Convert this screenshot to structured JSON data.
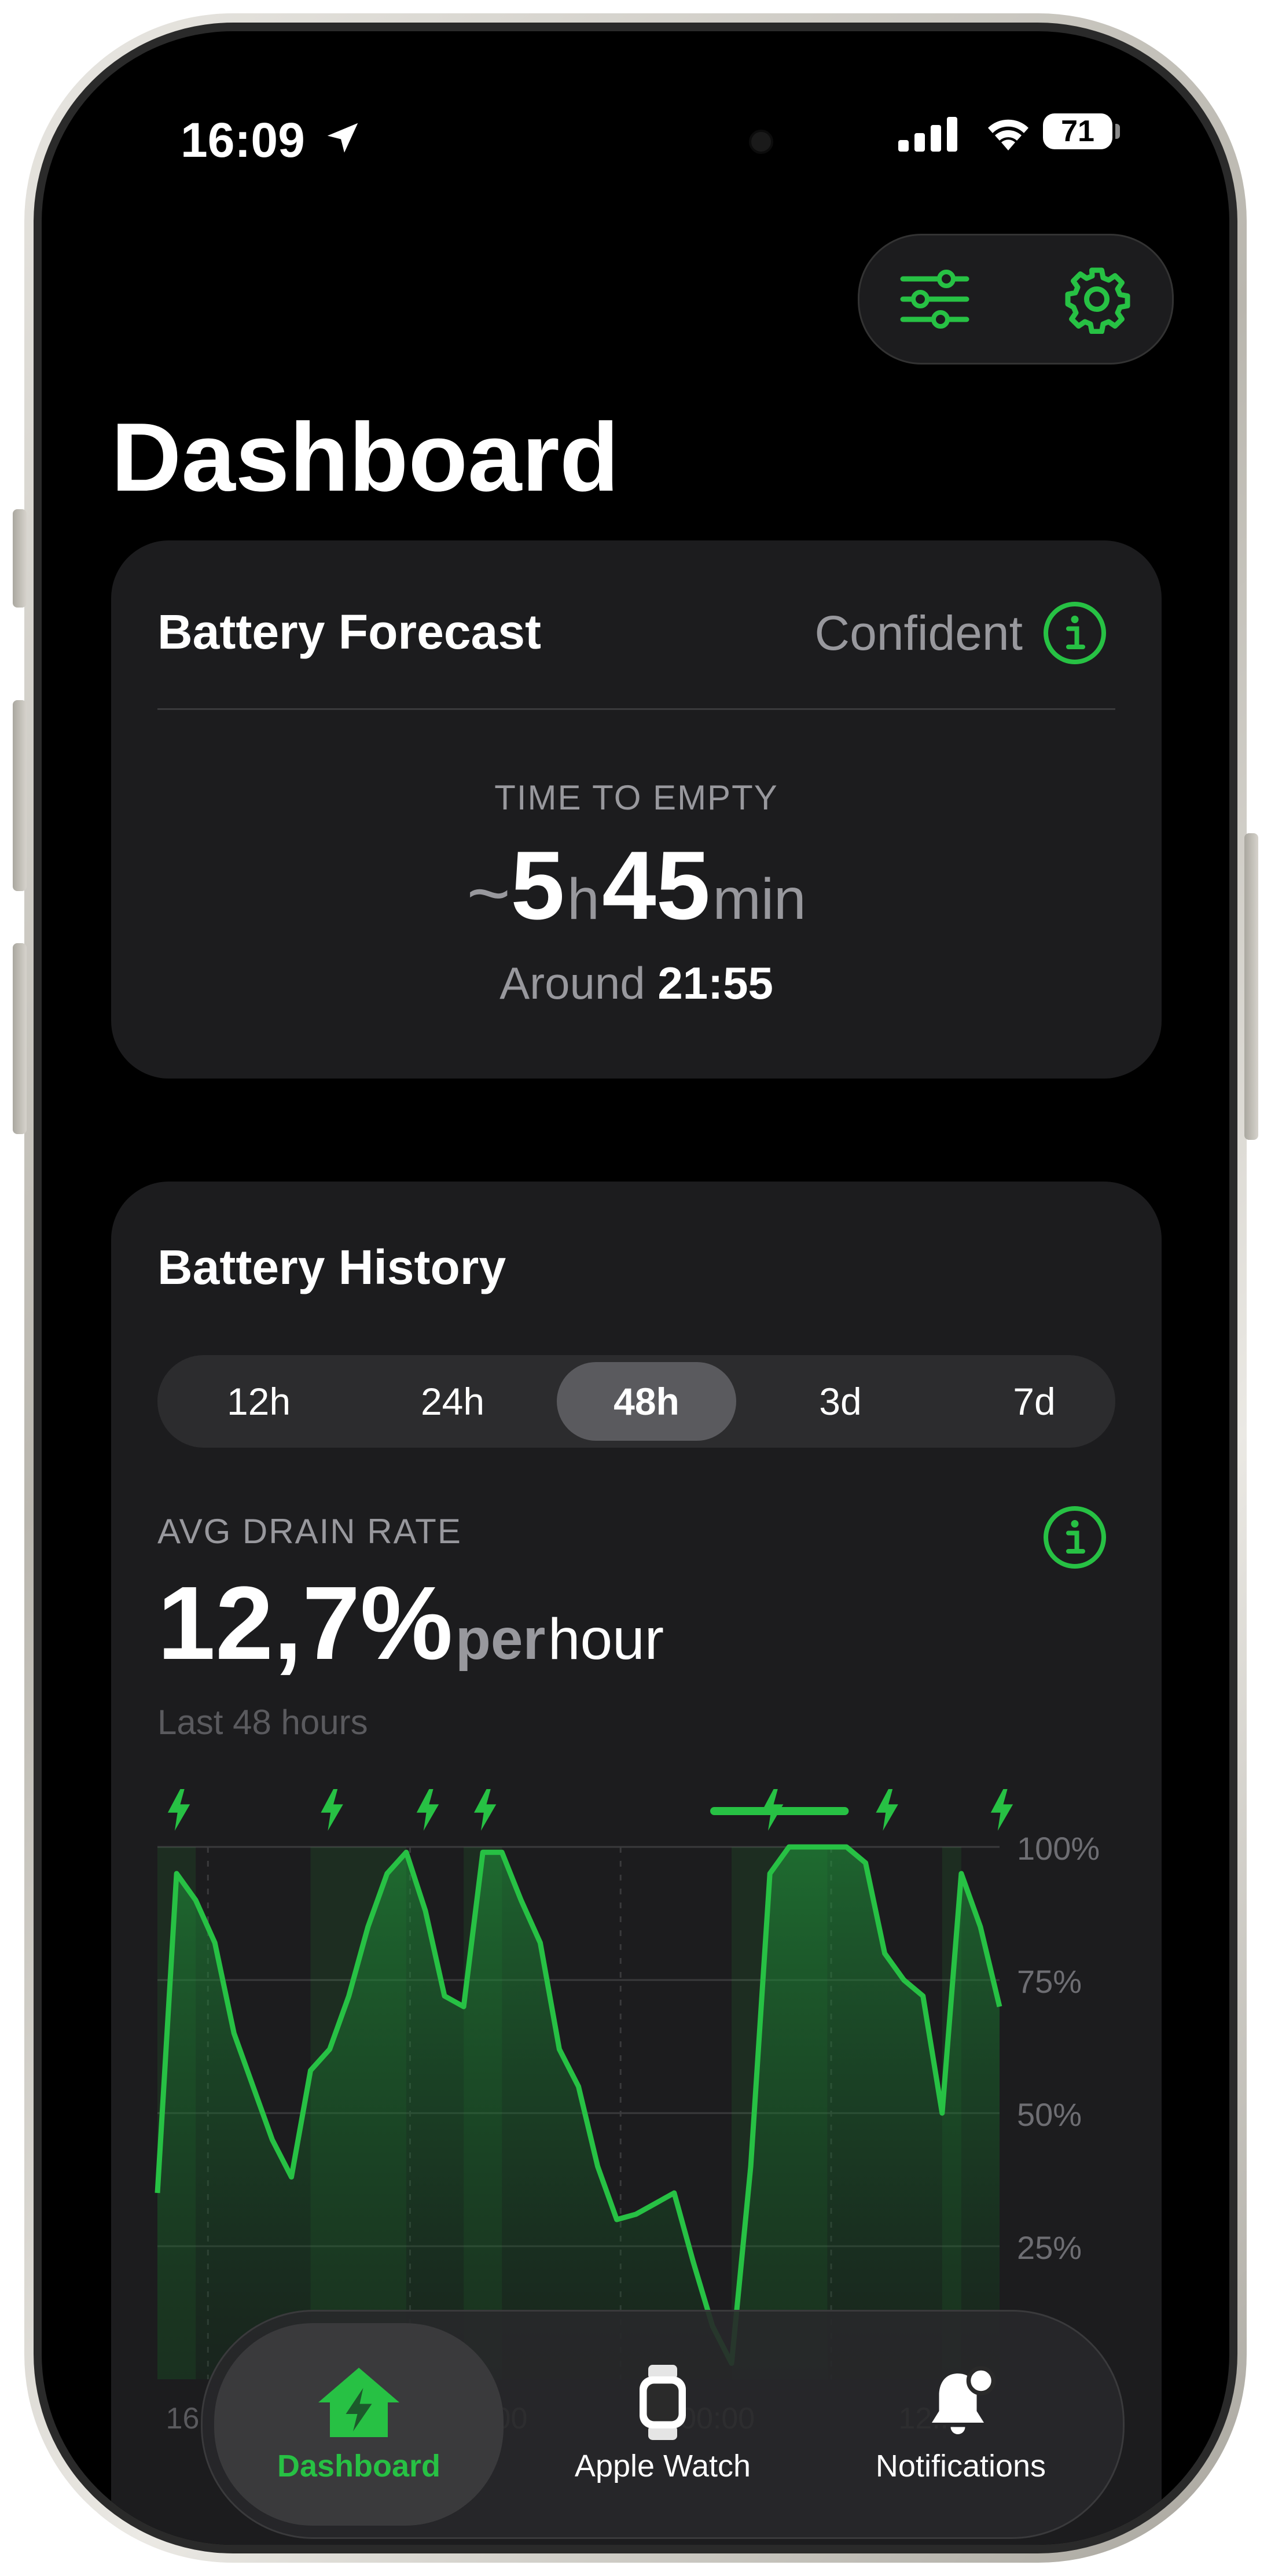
{
  "status_bar": {
    "time": "16:09",
    "battery_level": "71"
  },
  "header": {
    "title": "Dashboard"
  },
  "forecast_card": {
    "title": "Battery Forecast",
    "confidence": "Confident",
    "label": "TIME TO EMPTY",
    "prefix": "~",
    "hours": "5",
    "hours_unit": "h",
    "minutes": "45",
    "minutes_unit": "min",
    "around_label": "Around",
    "around_time": "21:55"
  },
  "history_card": {
    "title": "Battery History",
    "ranges": [
      "12h",
      "24h",
      "48h",
      "3d",
      "7d"
    ],
    "selected_range": "48h",
    "avg_label": "AVG DRAIN RATE",
    "avg_value": "12,7%",
    "avg_per": "per",
    "avg_unit": "hour",
    "avg_sub": "Last 48 hours"
  },
  "chart_data": {
    "type": "area",
    "y_tick_labels": [
      "100%",
      "75%",
      "50%",
      "25%"
    ],
    "ylim": [
      0,
      100
    ],
    "x_tick_labels": [
      "16",
      "12:00",
      "00:00",
      "12..."
    ],
    "values": [
      35,
      95,
      90,
      82,
      65,
      55,
      45,
      38,
      58,
      62,
      72,
      85,
      95,
      99,
      88,
      72,
      70,
      99,
      99,
      90,
      82,
      62,
      55,
      40,
      30,
      31,
      33,
      35,
      22,
      10,
      3,
      40,
      95,
      100,
      100,
      100,
      100,
      97,
      80,
      75,
      72,
      50,
      95,
      85,
      70
    ],
    "color": "#27c144"
  },
  "tabbar": {
    "tabs": [
      {
        "label": "Dashboard",
        "icon": "house-bolt-icon",
        "active": true
      },
      {
        "label": "Apple Watch",
        "icon": "apple-watch-icon",
        "active": false
      },
      {
        "label": "Notifications",
        "icon": "bell-badge-icon",
        "active": false
      }
    ]
  },
  "colors": {
    "accent": "#27c144",
    "card": "#1c1c1e",
    "secondary_text": "#98989d"
  }
}
